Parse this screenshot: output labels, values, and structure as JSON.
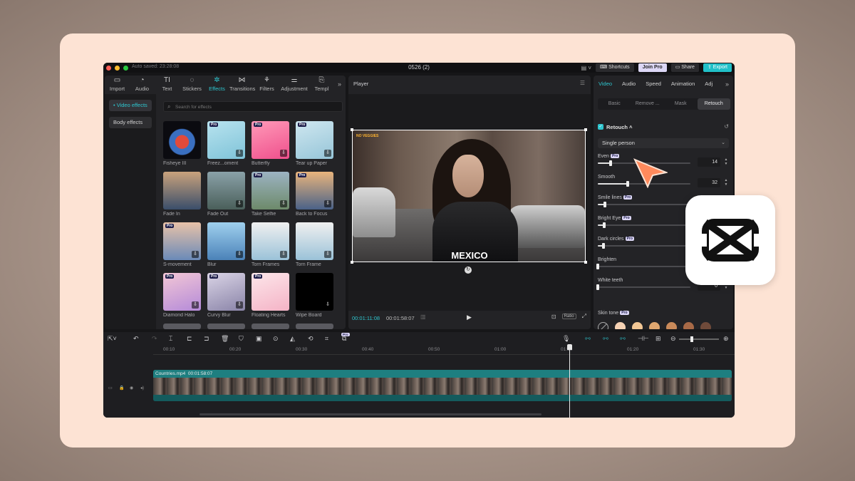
{
  "titlebar": {
    "autosaved": "Auto saved: 23:28:08",
    "project": "0526 (2)",
    "shortcuts": "Shortcuts",
    "join_pro": "Join Pro",
    "share": "Share",
    "export": "Export"
  },
  "toolbar": {
    "items": [
      {
        "label": "Import",
        "icon": "import-icon"
      },
      {
        "label": "Audio",
        "icon": "audio-icon"
      },
      {
        "label": "Text",
        "icon": "text-icon"
      },
      {
        "label": "Stickers",
        "icon": "stickers-icon"
      },
      {
        "label": "Effects",
        "icon": "effects-icon"
      },
      {
        "label": "Transitions",
        "icon": "transitions-icon"
      },
      {
        "label": "Filters",
        "icon": "filters-icon"
      },
      {
        "label": "Adjustment",
        "icon": "adjustment-icon"
      },
      {
        "label": "Templ",
        "icon": "templates-icon"
      }
    ],
    "active": "Effects"
  },
  "sidebar": {
    "items": [
      {
        "label": "• Video effects",
        "active": true
      },
      {
        "label": "Body effects",
        "active": false
      }
    ]
  },
  "search": {
    "placeholder": "Search for effects"
  },
  "effects": [
    {
      "label": "Fisheye III",
      "pro": false,
      "download": false
    },
    {
      "label": "Freez...oment",
      "pro": true,
      "download": true
    },
    {
      "label": "Butterfly",
      "pro": true,
      "download": true
    },
    {
      "label": "Tear up Paper",
      "pro": true,
      "download": true
    },
    {
      "label": "Fade In",
      "pro": false,
      "download": false
    },
    {
      "label": "Fade Out",
      "pro": false,
      "download": true
    },
    {
      "label": "Take Selfie",
      "pro": true,
      "download": true
    },
    {
      "label": "Back to Focus",
      "pro": true,
      "download": true
    },
    {
      "label": "S-movement",
      "pro": true,
      "download": true
    },
    {
      "label": "Blur",
      "pro": false,
      "download": true
    },
    {
      "label": "Torn Frames",
      "pro": false,
      "download": true
    },
    {
      "label": "Torn Frame",
      "pro": false,
      "download": true
    },
    {
      "label": "Diamond Halo",
      "pro": true,
      "download": true
    },
    {
      "label": "Curvy Blur",
      "pro": true,
      "download": true
    },
    {
      "label": "Floating Hearts",
      "pro": true,
      "download": false
    },
    {
      "label": "Wipe Board",
      "pro": false,
      "download": true
    }
  ],
  "pro_badge": "Pro",
  "player": {
    "title": "Player",
    "caption": "MEXICO",
    "overlay_logo": "NO VEGGIES",
    "current_time": "00:01:11:08",
    "total_time": "00:01:58:07",
    "ratio": "Ratio"
  },
  "inspector": {
    "tabs": [
      "Video",
      "Audio",
      "Speed",
      "Animation",
      "Adj"
    ],
    "active_tab": "Video",
    "subtabs": [
      "Basic",
      "Remove ...",
      "Mask",
      "Retouch"
    ],
    "active_subtab": "Retouch",
    "retouch_label": "Retouch",
    "mode": "Single person",
    "sliders": [
      {
        "label": "Even",
        "pro": true,
        "value": 14,
        "show_value": true
      },
      {
        "label": "Smooth",
        "pro": false,
        "value": 32,
        "show_value": true
      },
      {
        "label": "Smile lines",
        "pro": true,
        "value": 8,
        "show_value": false
      },
      {
        "label": "Bright Eye",
        "pro": true,
        "value": 7,
        "show_value": false
      },
      {
        "label": "Dark circles",
        "pro": true,
        "value": 6,
        "show_value": false
      },
      {
        "label": "Brighten",
        "pro": false,
        "value": 0,
        "show_value": false
      },
      {
        "label": "White teeth",
        "pro": false,
        "value": 0,
        "show_value": true
      }
    ],
    "skin_tone_label": "Skin tone",
    "skin_tones": [
      "#f6d2b4",
      "#f2c795",
      "#dfa770",
      "#c98a5a",
      "#a86a47",
      "#6f4a3a"
    ]
  },
  "timeline": {
    "ruler": [
      "00:10",
      "00:20",
      "00:30",
      "00:40",
      "00:50",
      "01:00",
      "01:10",
      "01:20",
      "01:30"
    ],
    "clip_title": "Countries.mp4",
    "clip_duration": "00:01:58:07"
  },
  "colors": {
    "accent": "#2ec6cf",
    "cursor": "#ff8a5c",
    "card": "#fde3d4"
  }
}
